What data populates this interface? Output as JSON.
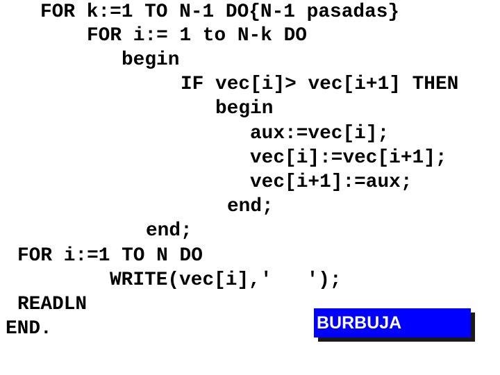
{
  "code": {
    "language": "Pascal",
    "lines": [
      "FOR k:=1 TO N-1 DO{N-1 pasadas}",
      "FOR i:= 1 to N-k DO",
      "begin",
      "IF vec[i]> vec[i+1] THEN",
      "begin",
      "aux:=vec[i];",
      "vec[i]:=vec[i+1];",
      "vec[i+1]:=aux;",
      "end;",
      "end;",
      "FOR i:=1 TO N DO",
      "WRITE(vec[i],'   ');",
      "READLN",
      "END."
    ]
  },
  "label": {
    "text": "BURBUJA",
    "background_color": "#0000ff",
    "text_color": "#ffffff",
    "shadow_color": "#1a1a1a"
  }
}
